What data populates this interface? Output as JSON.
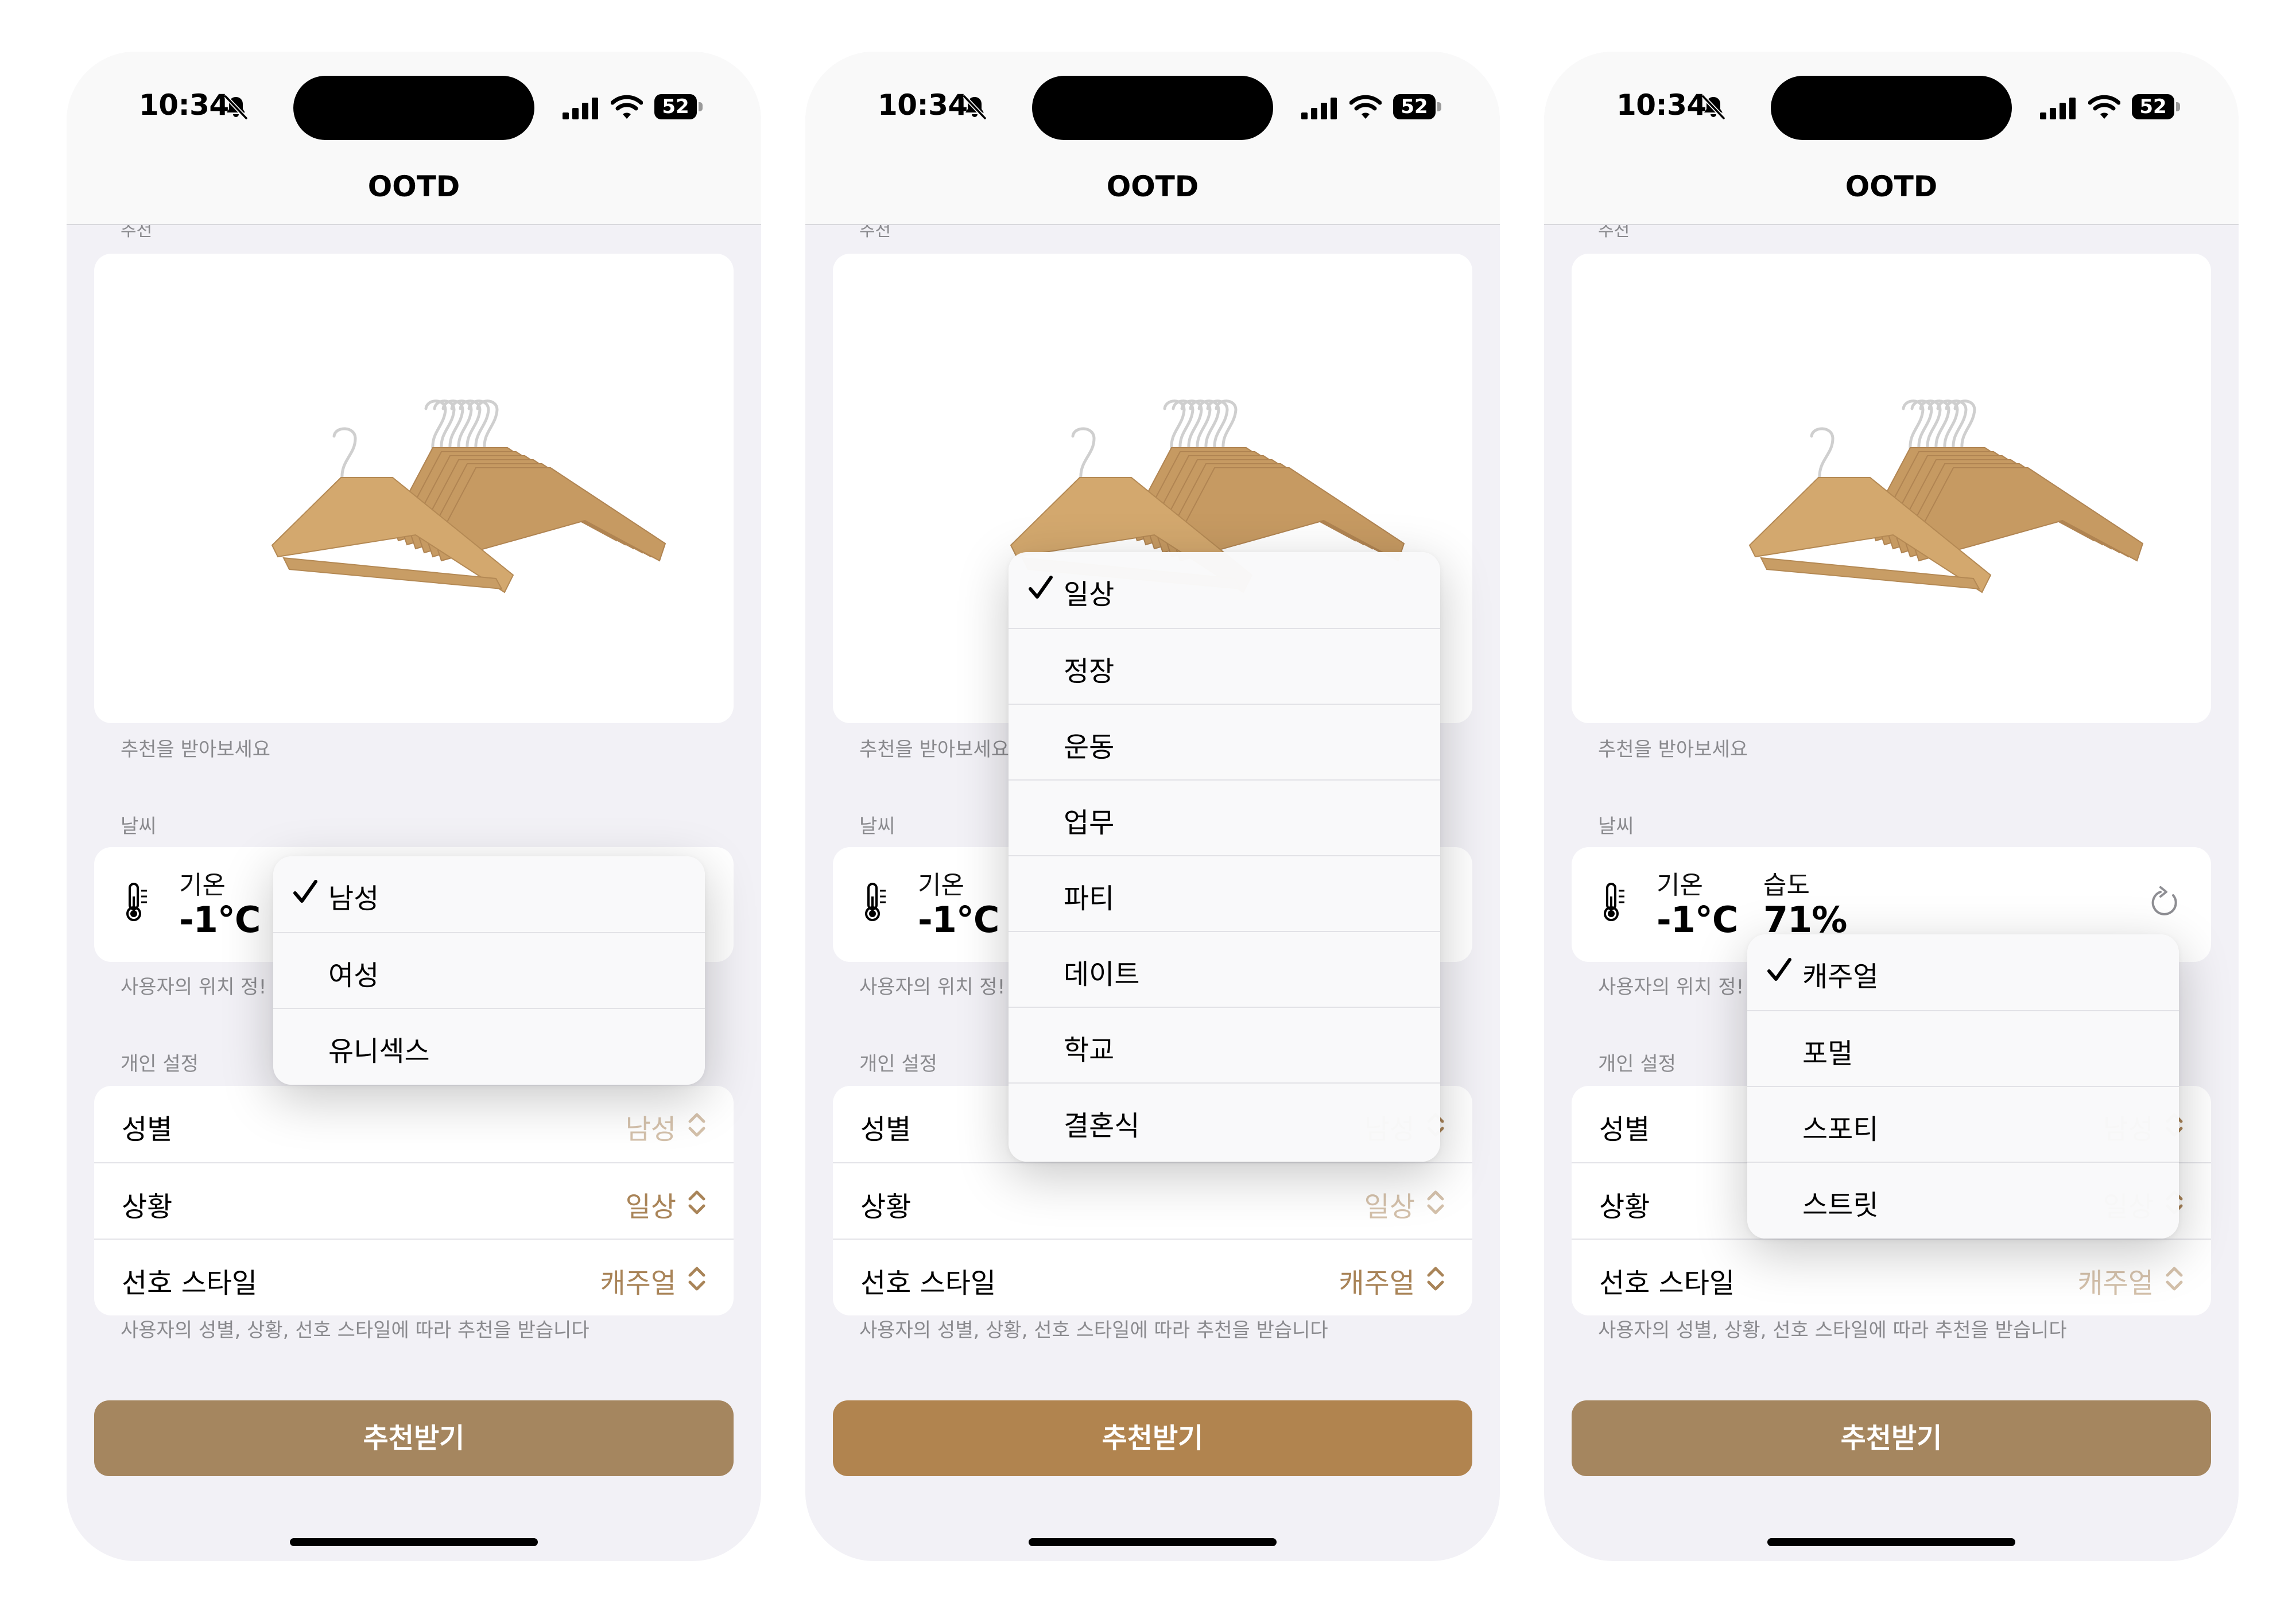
{
  "status_bar": {
    "time": "10:34",
    "battery": "52"
  },
  "nav": {
    "title": "OOTD",
    "section_peek": "추천"
  },
  "recommendation": {
    "caption": "추천을 받아보세요"
  },
  "weather": {
    "header": "날씨",
    "temperature_label": "기온",
    "temperature_value": "-1°C",
    "humidity_label": "습도",
    "humidity_value": "71%",
    "caption_cut": "사용자의 위치 정!"
  },
  "settings": {
    "header": "개인 설정",
    "gender_label": "성별",
    "gender_value": "남성",
    "situation_label": "상황",
    "situation_value": "일상",
    "style_label": "선호 스타일",
    "style_value": "캐주얼",
    "footer": "사용자의 성별, 상황, 선호 스타일에 따라 추천을 받습니다"
  },
  "cta_label": "추천받기",
  "menus": {
    "gender": [
      "남성",
      "여성",
      "유니섹스"
    ],
    "situation": [
      "일상",
      "정장",
      "운동",
      "업무",
      "파티",
      "데이트",
      "학교",
      "결혼식"
    ],
    "style": [
      "캐주얼",
      "포멀",
      "스포티",
      "스트릿"
    ]
  },
  "colors": {
    "accent": "#a98458",
    "button": "#a5865f",
    "background": "#f2f1f6"
  },
  "icons": [
    "bell-slash-icon",
    "cellular-signal-icon",
    "wifi-icon",
    "battery-icon",
    "thermometer-icon",
    "refresh-icon",
    "chevron-up-down-icon",
    "checkmark-icon"
  ]
}
